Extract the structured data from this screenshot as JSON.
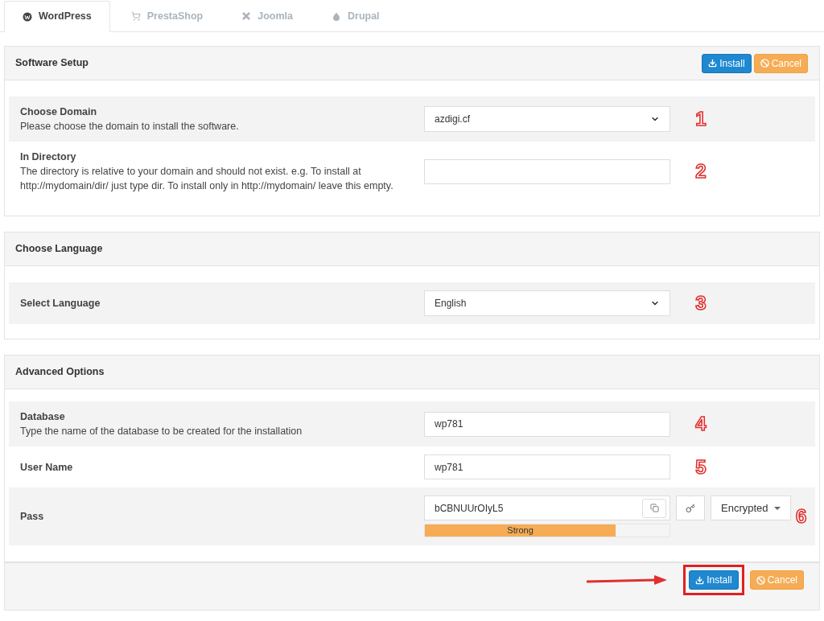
{
  "tabs": [
    {
      "label": "WordPress",
      "kind": "wordpress",
      "selected": true
    },
    {
      "label": "PrestaShop",
      "kind": "cart",
      "selected": false
    },
    {
      "label": "Joomla",
      "kind": "joomla",
      "selected": false
    },
    {
      "label": "Drupal",
      "kind": "drupal",
      "selected": false
    }
  ],
  "sections": [
    {
      "title": "Software Setup",
      "header_buttons": [
        {
          "kind": "install",
          "label": "Install"
        },
        {
          "kind": "cancel",
          "label": "Cancel"
        }
      ],
      "rows": [
        {
          "kind": "select",
          "label": "Choose Domain",
          "description": "Please choose the domain to install the software.",
          "value": "azdigi.cf",
          "marker": "1",
          "shaded": true
        },
        {
          "kind": "input",
          "label": "In Directory",
          "description": "The directory is relative to your domain and should not exist. e.g. To install at http://mydomain/dir/ just type dir. To install only in http://mydomain/ leave this empty.",
          "value": "",
          "marker": "2",
          "shaded": false
        }
      ]
    },
    {
      "title": "Choose Language",
      "rows": [
        {
          "kind": "select",
          "label": "Select Language",
          "value": "English",
          "marker": "3",
          "shaded": true
        }
      ]
    },
    {
      "title": "Advanced Options",
      "rows": [
        {
          "kind": "input",
          "label": "Database",
          "description": "Type the name of the database to be created for the installation",
          "value": "wp781",
          "marker": "4",
          "shaded": true
        },
        {
          "kind": "input",
          "label": "User Name",
          "value": "wp781",
          "marker": "5",
          "shaded": false
        },
        {
          "kind": "password",
          "label": "Pass",
          "value": "bCBNUUrOIyL5",
          "strength": {
            "label": "Strong",
            "level": 0.78
          },
          "mode": "Encrypted",
          "marker": "6",
          "shaded": true
        }
      ]
    }
  ],
  "footer_buttons": [
    {
      "kind": "install",
      "label": "Install",
      "highlighted": true
    },
    {
      "kind": "cancel",
      "label": "Cancel",
      "highlighted": false
    }
  ]
}
